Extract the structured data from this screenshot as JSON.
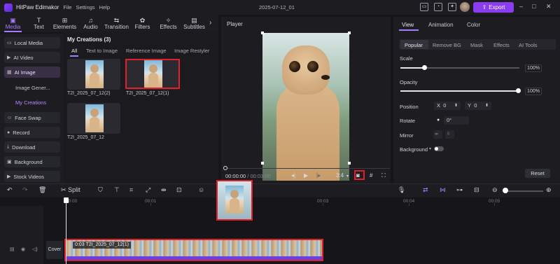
{
  "app": {
    "name": "HitPaw Edimakor",
    "menus": [
      "File",
      "Settings",
      "Help"
    ],
    "project_title": "2025-07-12_01",
    "export_label": "Export"
  },
  "toolbar": {
    "items": [
      "Media",
      "Text",
      "Elements",
      "Audio",
      "Transition",
      "Filters",
      "Effects",
      "Subtitles"
    ],
    "active": "Media"
  },
  "sidebar": {
    "items": [
      "Local Media",
      "AI Video",
      "AI Image"
    ],
    "sub_items": [
      "Image Gener...",
      "My Creations"
    ],
    "items2": [
      "Face Swap",
      "Record",
      "Download",
      "Background",
      "Stock Videos"
    ],
    "active": "AI Image",
    "active_sub": "My Creations"
  },
  "media": {
    "title": "My Creations (3)",
    "tabs": [
      "All",
      "Text to Image",
      "Reference Image",
      "Image Restyler"
    ],
    "active_tab": "All",
    "items": [
      "T2I_2025_07_12(2)",
      "T2I_2025_07_12(1)",
      "T2I_2025_07_12"
    ]
  },
  "player": {
    "title": "Player",
    "current_time": "00:00:00",
    "total_time": "/ 00:03:00",
    "aspect": "3:4"
  },
  "properties": {
    "tabs": [
      "View",
      "Animation",
      "Color"
    ],
    "active_tab": "View",
    "subtabs": [
      "Popular",
      "Remove BG",
      "Mask",
      "Effects",
      "AI Tools"
    ],
    "active_subtab": "Popular",
    "scale_label": "Scale",
    "scale_value": "100%",
    "scale_fraction": 0.2,
    "opacity_label": "Opacity",
    "opacity_value": "100%",
    "opacity_fraction": 1.0,
    "position_label": "Position",
    "x_label": "X",
    "x_value": "0",
    "y_label": "Y",
    "y_value": "0",
    "rotate_label": "Rotate",
    "rotate_value": "0°",
    "mirror_label": "Mirror",
    "background_label": "Background",
    "reset_label": "Reset"
  },
  "timeline": {
    "split_label": "Split",
    "ruler": [
      "00:00",
      "00:01",
      "00:03",
      "00:04",
      "00:05"
    ],
    "clip_label": "0:03  T2I_2025_07_12(1)",
    "cover_label": "Cover"
  },
  "colors": {
    "accent": "#8a3cf0",
    "highlight": "#e0202a",
    "clip": "#6c3bd6"
  }
}
